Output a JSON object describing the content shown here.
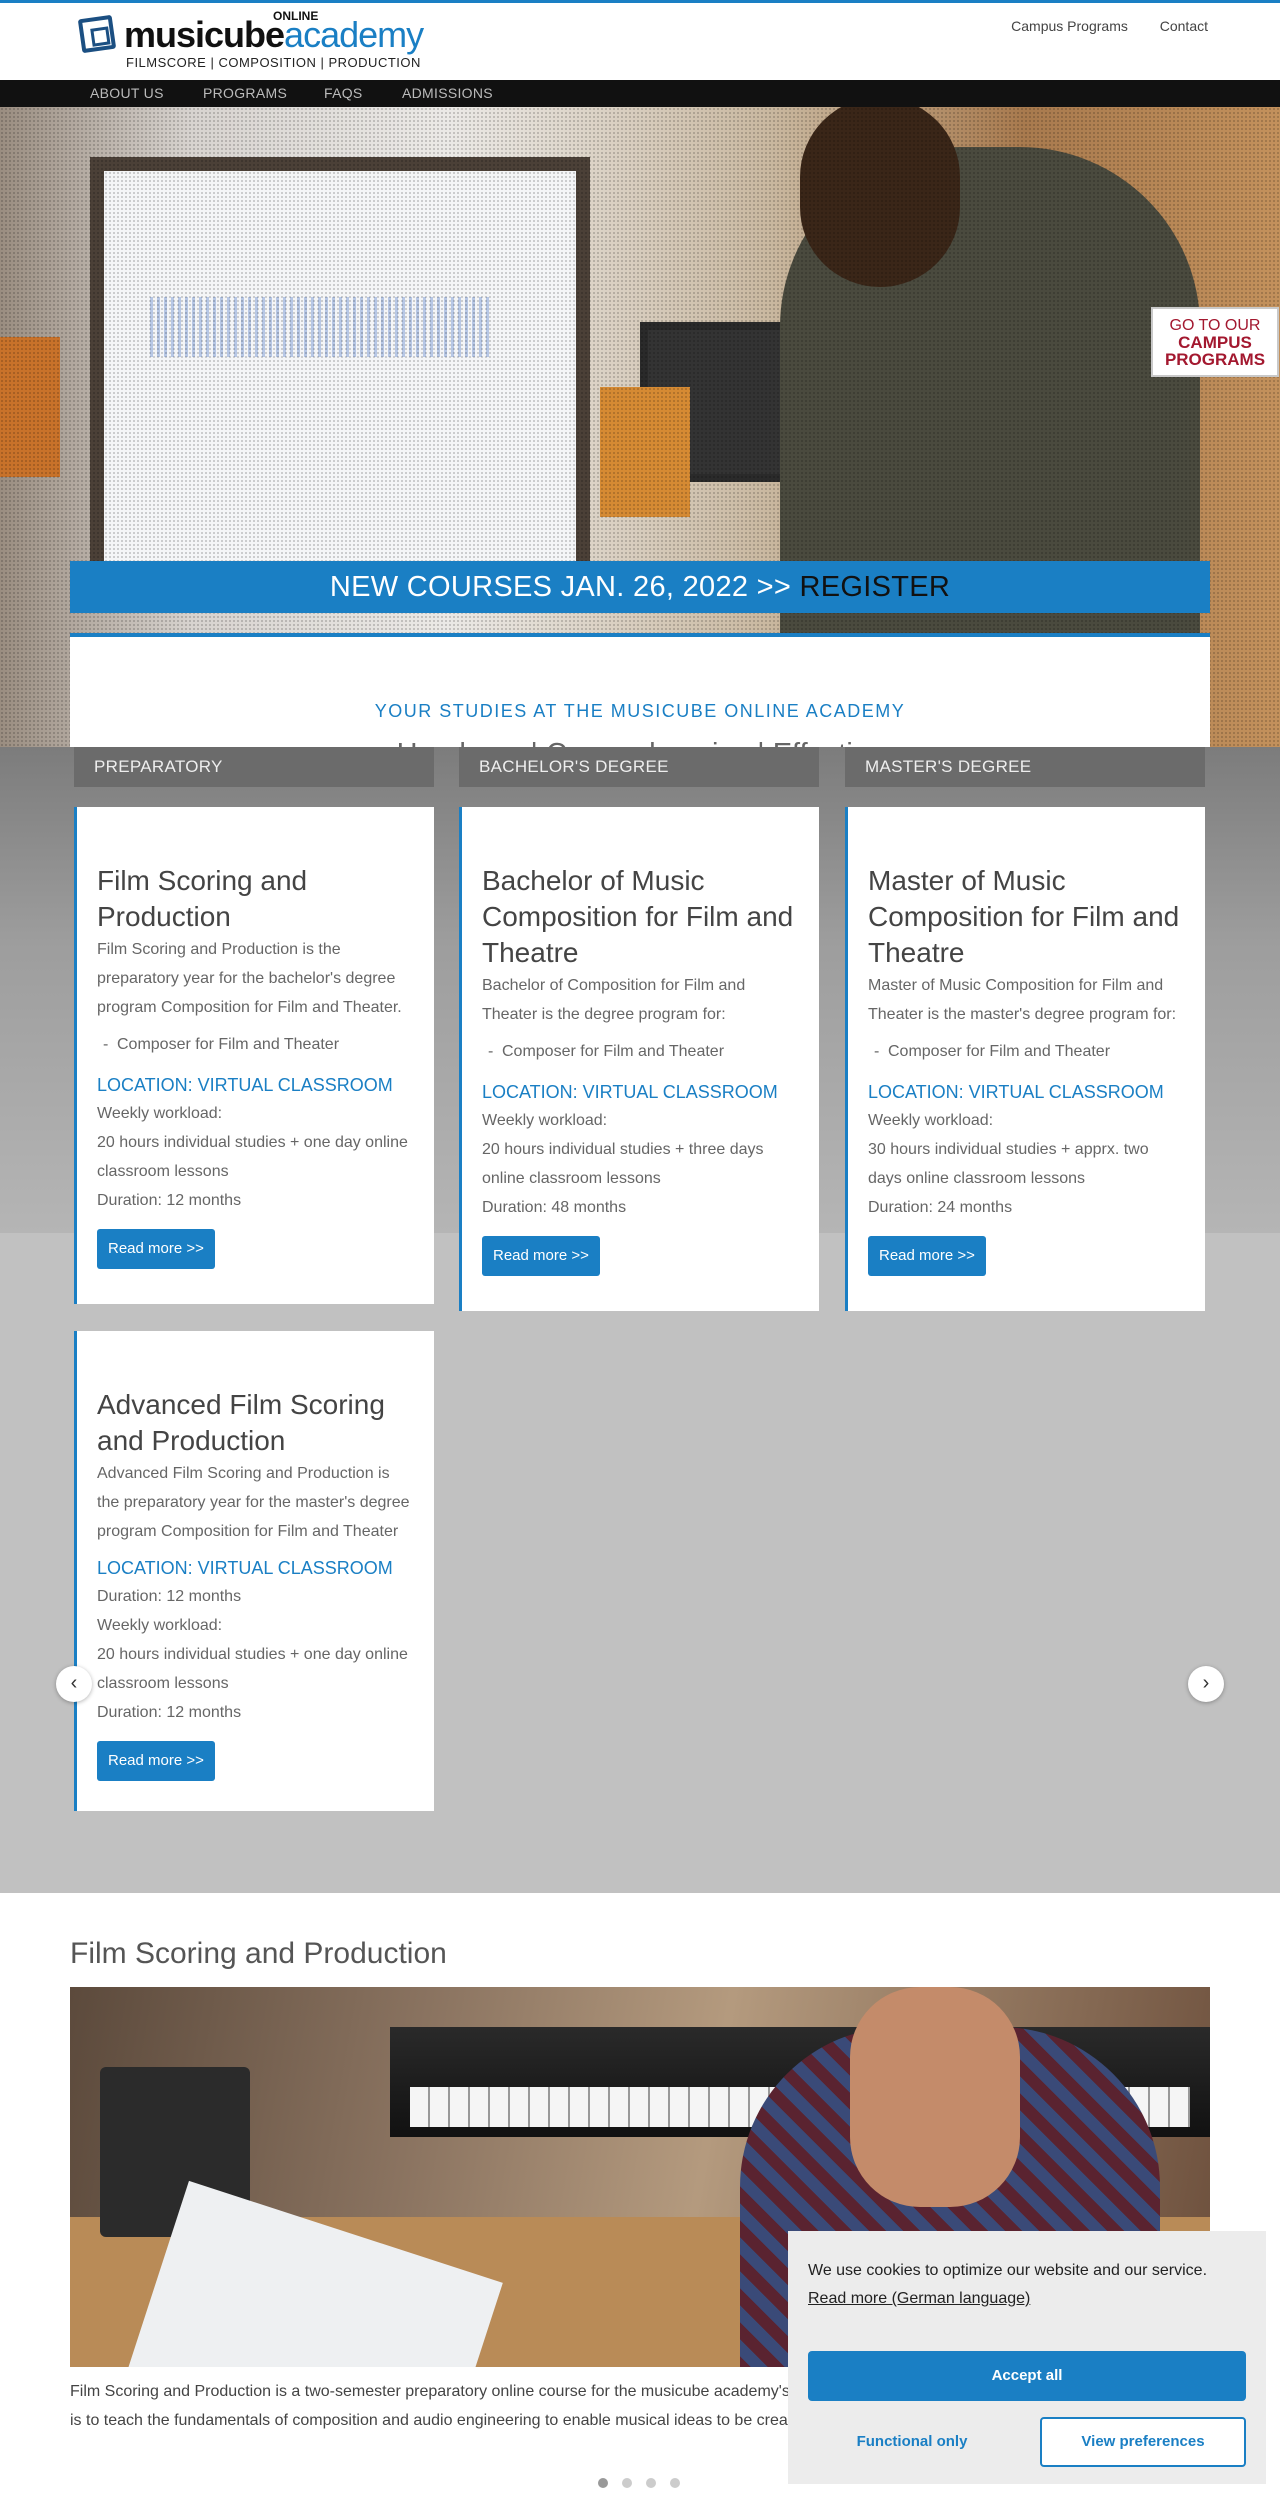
{
  "logo": {
    "word_bold": "musicube",
    "word_light": "academy",
    "online": "ONLINE",
    "tagline": "FILMSCORE | COMPOSITION | PRODUCTION"
  },
  "toplinks": [
    "Campus Programs",
    "Contact"
  ],
  "nav": [
    "ABOUT US",
    "PROGRAMS",
    "FAQS",
    "ADMISSIONS"
  ],
  "hero": {
    "campus_line1": "GO TO OUR",
    "campus_line2": "CAMPUS",
    "campus_line3": "PROGRAMS",
    "register_text": "NEW COURSES JAN. 26, 2022 >>",
    "register_link": "REGISTER",
    "kicker": "YOUR STUDIES AT THE MUSICUBE ONLINE ACADEMY",
    "tagline": "Hands-on | Comprehensive | Effective"
  },
  "tabs": [
    "PREPARATORY",
    "BACHELOR'S DEGREE",
    "MASTER'S DEGREE"
  ],
  "cards": [
    {
      "title": "Film Scoring and Production",
      "intro": "Film Scoring and Production is the preparatory year for the bachelor's degree program Composition for Film and Theater.",
      "bullet": "Composer for Film and Theater",
      "location": "LOCATION: VIRTUAL CLASSROOM",
      "workload_label": "Weekly workload:",
      "workload": "20 hours individual studies + one day online classroom lessons",
      "duration": "Duration: 12 months",
      "button": "Read more >>"
    },
    {
      "title": "Bachelor of Music Composition for Film and Theatre",
      "intro": "Bachelor of Composition for Film and Theater is the degree program for:",
      "bullet": "Composer for Film and Theater",
      "location": "LOCATION: VIRTUAL CLASSROOM",
      "workload_label": "Weekly workload:",
      "workload": "20 hours individual studies + three days online classroom lessons",
      "duration": "Duration: 48 months",
      "button": "Read more >>"
    },
    {
      "title": "Master of Music Composition for Film and Theatre",
      "intro": "Master of Music Composition for Film and Theater is the master's degree program for:",
      "bullet": "Composer for Film and Theater",
      "location": "LOCATION: VIRTUAL CLASSROOM",
      "workload_label": "Weekly workload:",
      "workload": "30 hours individual studies + apprx. two days online classroom lessons",
      "duration": "Duration: 24 months",
      "button": "Read more >>"
    },
    {
      "title": "Advanced Film Scoring and Production",
      "intro": "Advanced Film Scoring and Production is the preparatory year for the master's degree program Composition for Film and Theater",
      "location": "LOCATION: VIRTUAL CLASSROOM",
      "duration_top": "Duration: 12 months",
      "workload_label": "Weekly workload:",
      "workload": "20 hours individual studies + one day online classroom lessons",
      "duration": "Duration: 12 months",
      "button": "Read more >>"
    }
  ],
  "section2": {
    "title": "Film Scoring and Production",
    "desc_line1": "Film Scoring and Production is a two-semester preparatory online course for the musicube academy's F",
    "desc_line2": "is to teach the fundamentals of composition and audio engineering to enable musical ideas to be create",
    "prev_icon": "chevron-left-icon",
    "next_icon": "chevron-right-icon",
    "slides": 4,
    "active_slide": 1
  },
  "cookie": {
    "message": "We use cookies to optimize our website and our service.",
    "link": "Read more (German language)",
    "accept": "Accept all",
    "functional": "Functional only",
    "preferences": "View preferences"
  },
  "colors": {
    "brand_blue": "#1a7fc4",
    "campus_red": "#a3182f",
    "nav_black": "#111111",
    "tab_grey": "#6b6b6b"
  }
}
